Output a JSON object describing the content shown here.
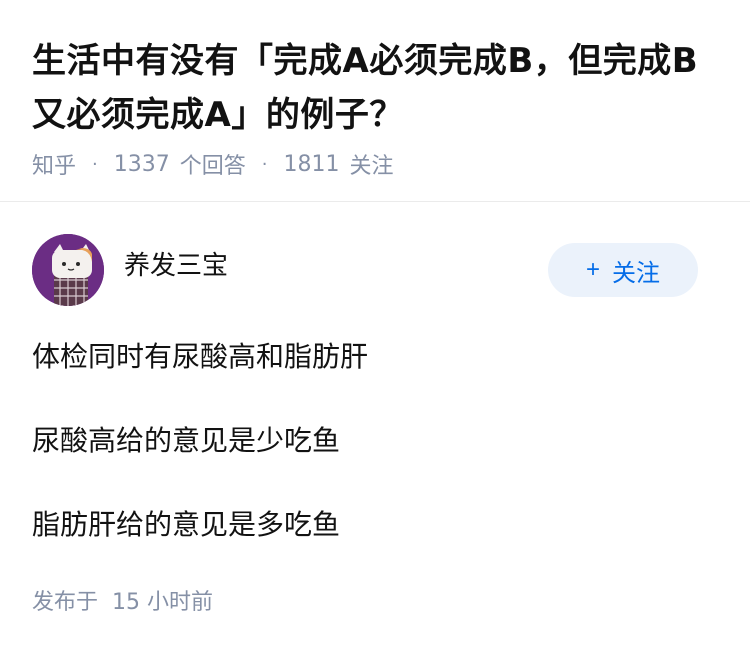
{
  "question": {
    "title": "生活中有没有「完成A必须完成B，但完成B又必须完成A」的例子？",
    "source": "知乎",
    "answer_count": "1337",
    "answer_label": "个回答",
    "follower_count": "1811",
    "follower_label": "关注"
  },
  "answer": {
    "author": {
      "name": "养发三宝",
      "avatar_icon": "cartoon-avatar-icon"
    },
    "follow_button": {
      "icon": "+",
      "label": "关注"
    },
    "paragraphs": [
      "体检同时有尿酸高和脂肪肝",
      "尿酸高给的意见是少吃鱼",
      "脂肪肝给的意见是多吃鱼"
    ],
    "publish": {
      "prefix": "发布于",
      "time": "15 小时前"
    }
  },
  "colors": {
    "title": "#121212",
    "meta": "#8590a6",
    "follow_bg": "#ebf2fb",
    "follow_text": "#056de8",
    "avatar_bg": "#6b2d84"
  }
}
